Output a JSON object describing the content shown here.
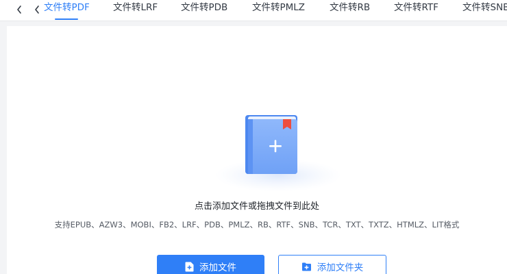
{
  "tabs": [
    {
      "label": "文件转PDF",
      "active": true
    },
    {
      "label": "文件转LRF",
      "active": false
    },
    {
      "label": "文件转PDB",
      "active": false
    },
    {
      "label": "文件转PMLZ",
      "active": false
    },
    {
      "label": "文件转RB",
      "active": false
    },
    {
      "label": "文件转RTF",
      "active": false
    },
    {
      "label": "文件转SNB",
      "active": false
    }
  ],
  "drop_zone": {
    "prompt": "点击添加文件或拖拽文件到此处",
    "supported_formats": "支持EPUB、AZW3、MOBI、FB2、LRF、PDB、PMLZ、RB、RTF、SNB、TCR、TXT、TXTZ、HTMLZ、LIT格式"
  },
  "buttons": {
    "add_file": "添加文件",
    "add_folder": "添加文件夹"
  },
  "icons": {
    "nav_back": "chevron-left-icon",
    "illustration": "book-add-icon",
    "add_file": "file-plus-icon",
    "add_folder": "folder-plus-icon"
  },
  "colors": {
    "accent": "#2f7ff7",
    "bookmark": "#ee4d3d",
    "text_primary": "#1f2329",
    "text_secondary": "#555b64"
  }
}
